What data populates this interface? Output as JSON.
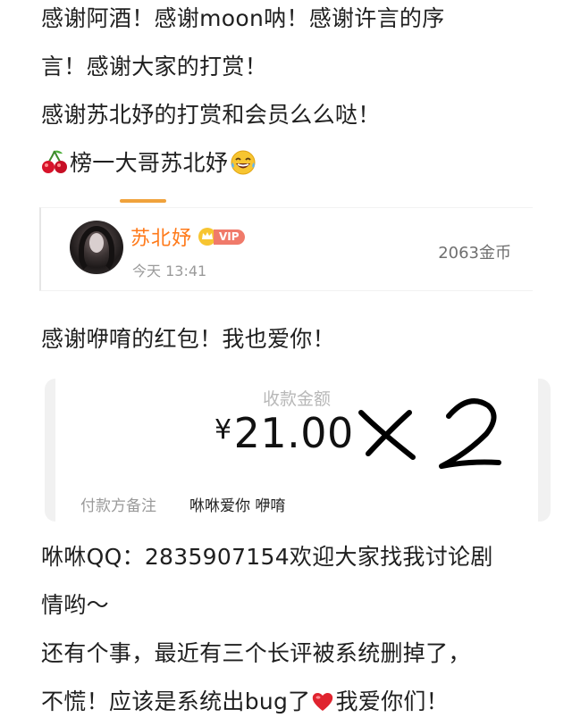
{
  "intro": {
    "lines": [
      "感谢阿酒！感谢moon呐！感谢许言的序",
      "言！感谢大家的打赏！",
      "感谢苏北妤的打赏和会员么么哒！",
      "榜一大哥苏北妤"
    ]
  },
  "reward_card": {
    "name": "苏北妤",
    "vip": "VIP",
    "time": "今天 13:41",
    "coins": "2063金币"
  },
  "after_reward": {
    "line": "感谢咿唷的红包！我也爱你！"
  },
  "payment": {
    "title": "收款金额",
    "currency": "¥",
    "amount": "21.00",
    "note_label": "付款方备注",
    "note_value": "咻咻爱你 咿唷"
  },
  "outro": {
    "lines": [
      "咻咻QQ：2835907154欢迎大家找我讨论剧",
      "情哟～",
      "还有个事，最近有三个长评被系统删掉了，",
      "不慌！应该是系统出bug了",
      "我爱你们！"
    ]
  },
  "icons": [
    "cherry-icon",
    "laughing-face-icon",
    "heart-icon",
    "vip-crown-icon"
  ],
  "colors": {
    "accent": "#f0a23c",
    "reward_name": "#ff7a1a",
    "vip": "#f07a6a",
    "heart": "#e0242f"
  }
}
